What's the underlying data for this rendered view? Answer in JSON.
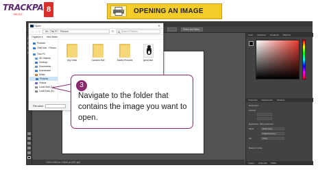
{
  "header": {
    "brand": "TRACKPAD",
    "brand_number": "8",
    "brand_sub": "Ver. 3.0",
    "title": "OPENING AN IMAGE"
  },
  "dialog": {
    "title": "Open",
    "address": "All  ›  This PC  ›  Pictures",
    "search_placeholder": "Search Pictures",
    "organize": "Organize ▾",
    "new_folder": "New folder",
    "nav_items": [
      {
        "label": "Pictures",
        "color": "#3b78c4"
      },
      {
        "label": "OneDrive - Person",
        "color": "#2f7ad8"
      },
      {
        "label": "This PC",
        "color": "#4a8cd6"
      },
      {
        "label": "3D Objects",
        "color": "#5aa0e0"
      },
      {
        "label": "Desktop",
        "color": "#3b78c4"
      },
      {
        "label": "Documents",
        "color": "#6f8fb5"
      },
      {
        "label": "Downloads",
        "color": "#2f7ad8"
      },
      {
        "label": "Music",
        "color": "#d07a3a"
      },
      {
        "label": "Pictures",
        "color": "#3b78c4"
      },
      {
        "label": "Videos",
        "color": "#7a5fc4"
      },
      {
        "label": "Local Disk (C:)",
        "color": "#888888"
      },
      {
        "label": "Local Disk (D:)",
        "color": "#888888"
      }
    ],
    "files": [
      {
        "label": "Any Desk",
        "type": "folder"
      },
      {
        "label": "Camera Roll",
        "type": "folder"
      },
      {
        "label": "Saved Pictures",
        "type": "folder"
      },
      {
        "label": "great auk",
        "type": "image"
      }
    ],
    "file_name_label": "File name:"
  },
  "photoshop": {
    "options_button_1": "Select and Mask...",
    "panel_tabs_top": [
      "Color",
      "Swatches",
      "Gradients",
      "Patterns"
    ],
    "panel_tabs_props": [
      "Properties",
      "Adjustments",
      "Libraries"
    ],
    "panel_tabs_bottom": [
      "Layers",
      "Channels",
      "Paths"
    ],
    "props_labels": [
      "Document",
      "Canvas",
      "Resolution: 300 pixels/inch",
      "Mode",
      "RGB Color",
      "8 Bits/Channel",
      "Fill",
      "White",
      "Rulers & Grids"
    ],
    "status": "100%    2480 px x 3508 px (300 ppi)"
  },
  "callout": {
    "step": "3",
    "text": "Navigate to the folder that contains the image you want to open."
  }
}
